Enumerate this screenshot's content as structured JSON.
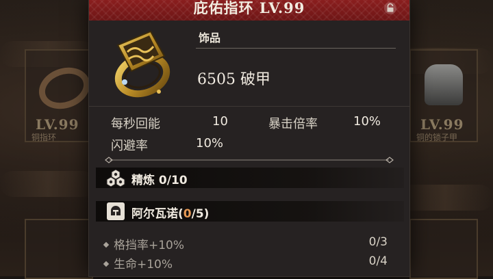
{
  "item": {
    "title": "庇佑指环 LV.99",
    "category": "饰品",
    "main_stat_value": "6505",
    "main_stat_name": "破甲"
  },
  "stats": [
    {
      "label": "每秒回能",
      "value": "10"
    },
    {
      "label": "暴击倍率",
      "value": "10%"
    },
    {
      "label": "闪避率",
      "value": "10%"
    }
  ],
  "refine": {
    "label": "精炼",
    "value": "0/10"
  },
  "set": {
    "name": "阿尔瓦诺",
    "open": "(",
    "current": "0",
    "total_part": "/5)"
  },
  "bonuses": [
    {
      "label": "格挡率+10%",
      "progress": "0/3"
    },
    {
      "label": "生命+10%",
      "progress": "0/4"
    }
  ],
  "background": {
    "left_card": {
      "level": "LV.99",
      "name": "铜指环"
    },
    "right_card": {
      "level": "LV.99",
      "name": "铜的锁子甲"
    }
  },
  "colors": {
    "title_bar": "#7a1a1a",
    "panel": "#262222",
    "set_progress_accent": "#e89a55"
  },
  "icons": {
    "lock": "lock-icon",
    "item": "ring-icon",
    "refine": "honeycomb-icon",
    "set": "helmet-icon"
  }
}
